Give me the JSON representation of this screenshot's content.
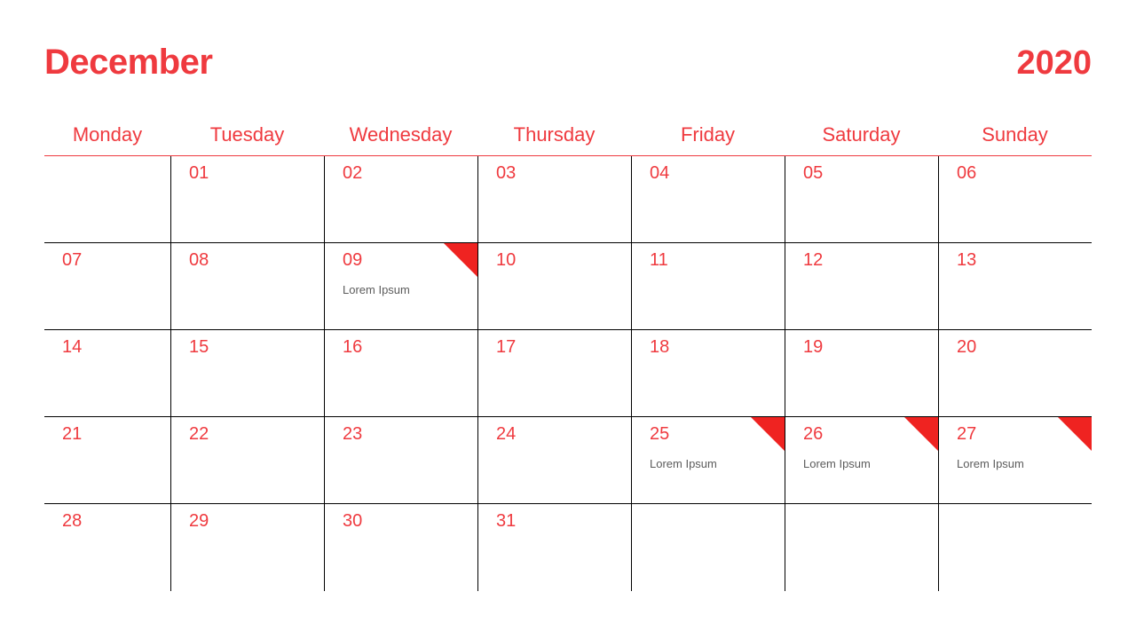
{
  "header": {
    "month": "December",
    "year": "2020"
  },
  "weekdays": [
    "Monday",
    "Tuesday",
    "Wednesday",
    "Thursday",
    "Friday",
    "Saturday",
    "Sunday"
  ],
  "colors": {
    "accent": "#ef3a3f"
  },
  "weeks": [
    [
      {
        "num": "",
        "note": "",
        "marked": false
      },
      {
        "num": "01",
        "note": "",
        "marked": false
      },
      {
        "num": "02",
        "note": "",
        "marked": false
      },
      {
        "num": "03",
        "note": "",
        "marked": false
      },
      {
        "num": "04",
        "note": "",
        "marked": false
      },
      {
        "num": "05",
        "note": "",
        "marked": false
      },
      {
        "num": "06",
        "note": "",
        "marked": false
      }
    ],
    [
      {
        "num": "07",
        "note": "",
        "marked": false
      },
      {
        "num": "08",
        "note": "",
        "marked": false
      },
      {
        "num": "09",
        "note": "Lorem Ipsum",
        "marked": true
      },
      {
        "num": "10",
        "note": "",
        "marked": false
      },
      {
        "num": "11",
        "note": "",
        "marked": false
      },
      {
        "num": "12",
        "note": "",
        "marked": false
      },
      {
        "num": "13",
        "note": "",
        "marked": false
      }
    ],
    [
      {
        "num": "14",
        "note": "",
        "marked": false
      },
      {
        "num": "15",
        "note": "",
        "marked": false
      },
      {
        "num": "16",
        "note": "",
        "marked": false
      },
      {
        "num": "17",
        "note": "",
        "marked": false
      },
      {
        "num": "18",
        "note": "",
        "marked": false
      },
      {
        "num": "19",
        "note": "",
        "marked": false
      },
      {
        "num": "20",
        "note": "",
        "marked": false
      }
    ],
    [
      {
        "num": "21",
        "note": "",
        "marked": false
      },
      {
        "num": "22",
        "note": "",
        "marked": false
      },
      {
        "num": "23",
        "note": "",
        "marked": false
      },
      {
        "num": "24",
        "note": "",
        "marked": false
      },
      {
        "num": "25",
        "note": "Lorem Ipsum",
        "marked": true
      },
      {
        "num": "26",
        "note": "Lorem Ipsum",
        "marked": true
      },
      {
        "num": "27",
        "note": "Lorem Ipsum",
        "marked": true
      }
    ],
    [
      {
        "num": "28",
        "note": "",
        "marked": false
      },
      {
        "num": "29",
        "note": "",
        "marked": false
      },
      {
        "num": "30",
        "note": "",
        "marked": false
      },
      {
        "num": "31",
        "note": "",
        "marked": false
      },
      {
        "num": "",
        "note": "",
        "marked": false
      },
      {
        "num": "",
        "note": "",
        "marked": false
      },
      {
        "num": "",
        "note": "",
        "marked": false
      }
    ]
  ]
}
